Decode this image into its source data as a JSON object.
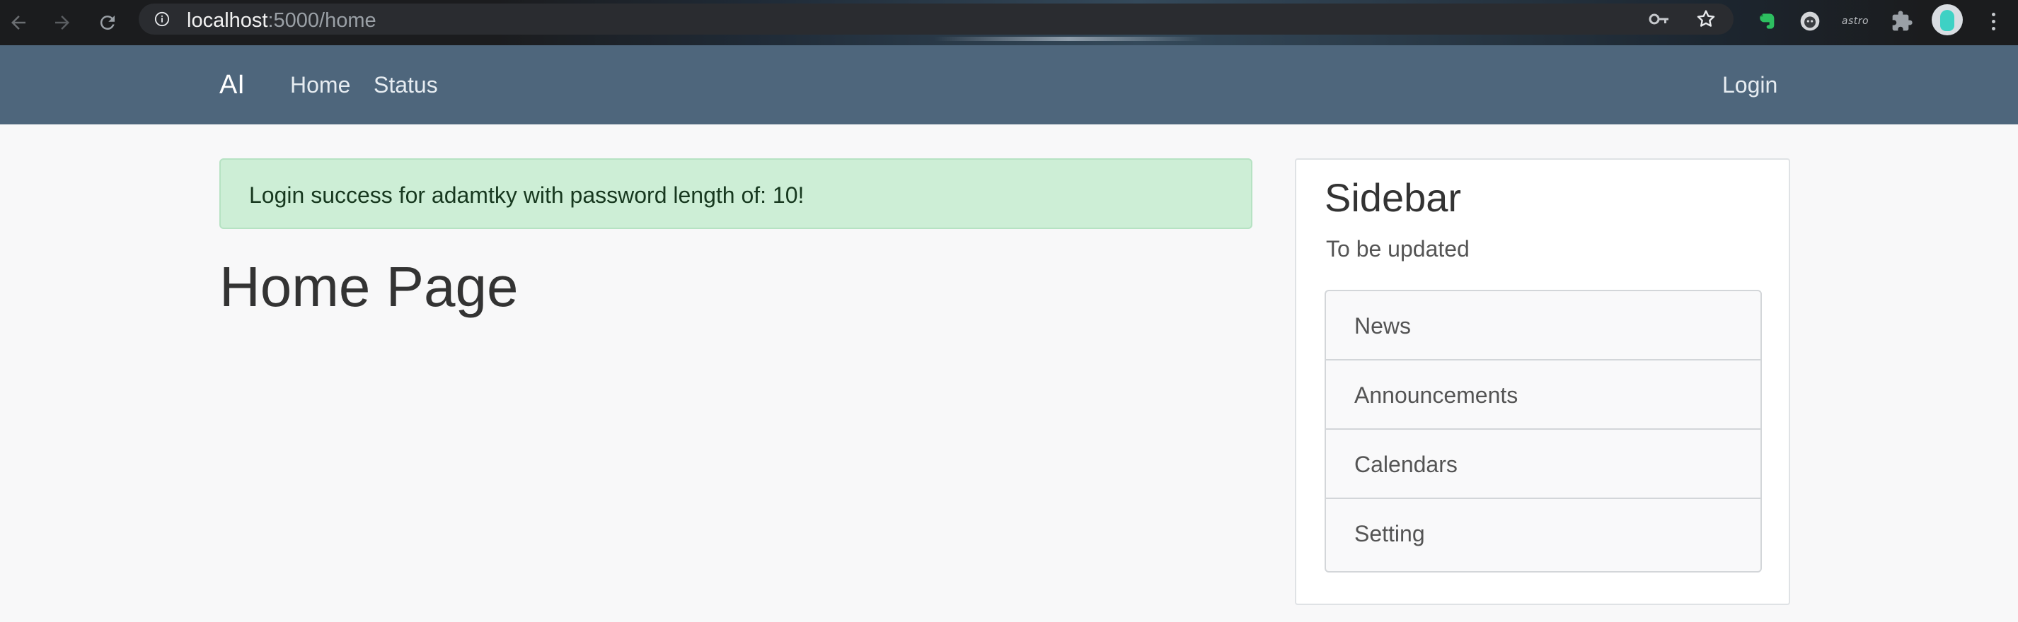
{
  "browser": {
    "url_host": "localhost",
    "url_path": ":5000/home",
    "extensions": [
      {
        "name": "evernote-icon"
      },
      {
        "name": "octocat-icon"
      },
      {
        "name": "astro-extension",
        "label": "astro"
      },
      {
        "name": "puzzle-icon"
      }
    ]
  },
  "navbar": {
    "brand": "AI",
    "links": [
      "Home",
      "Status"
    ],
    "login": "Login"
  },
  "alert": {
    "message": "Login success for adamtky with password length of: 10!",
    "color": "#cdeed6"
  },
  "main": {
    "title": "Home Page"
  },
  "sidebar": {
    "title": "Sidebar",
    "subtitle": "To be updated",
    "items": [
      "News",
      "Announcements",
      "Calendars",
      "Setting"
    ]
  },
  "colors": {
    "navbar": "#4e667c",
    "page_background": "#f8f8f9",
    "browser_bar": "#1b1c1e"
  }
}
